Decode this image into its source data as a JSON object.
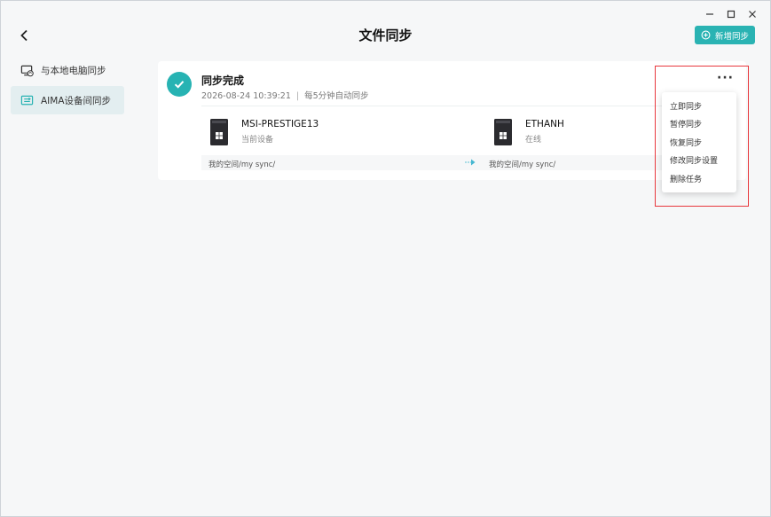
{
  "header": {
    "title": "文件同步",
    "add_button": "新增同步"
  },
  "sidebar": {
    "items": [
      {
        "label": "与本地电脑同步"
      },
      {
        "label": "AIMA设备间同步"
      }
    ]
  },
  "task": {
    "status": "同步完成",
    "timestamp": "2026-08-24 10:39:21",
    "schedule": "每5分钟自动同步",
    "source": {
      "name": "MSI-PRESTIGE13",
      "state": "当前设备",
      "path": "我的空间/my sync/"
    },
    "target": {
      "name": "ETHANH",
      "state": "在线",
      "path": "我的空间/my sync/"
    }
  },
  "menu": {
    "items": [
      "立即同步",
      "暂停同步",
      "恢复同步",
      "修改同步设置",
      "删除任务"
    ]
  },
  "colors": {
    "accent": "#2ab3b3",
    "highlight": "#e8383d"
  }
}
